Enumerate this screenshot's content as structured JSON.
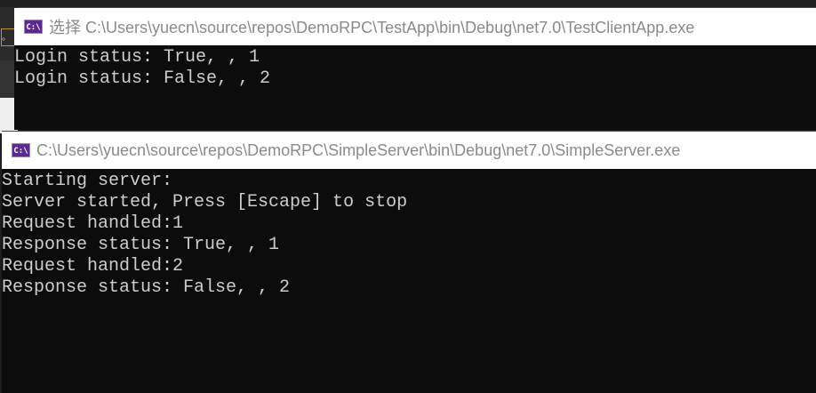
{
  "background": {
    "marker": "。"
  },
  "client_window": {
    "title": "选择 C:\\Users\\yuecn\\source\\repos\\DemoRPC\\TestApp\\bin\\Debug\\net7.0\\TestClientApp.exe",
    "icon": "cmd-icon",
    "icon_text": "C:\\",
    "lines": [
      "Login status: True, , 1",
      "Login status: False, , 2"
    ]
  },
  "server_window": {
    "title": "C:\\Users\\yuecn\\source\\repos\\DemoRPC\\SimpleServer\\bin\\Debug\\net7.0\\SimpleServer.exe",
    "icon": "cmd-icon",
    "icon_text": "C:\\",
    "lines": [
      "Starting server:",
      "Server started, Press [Escape] to stop",
      "Request handled:1",
      "Response status: True, , 1",
      "Request handled:2",
      "Response status: False, , 2"
    ]
  }
}
